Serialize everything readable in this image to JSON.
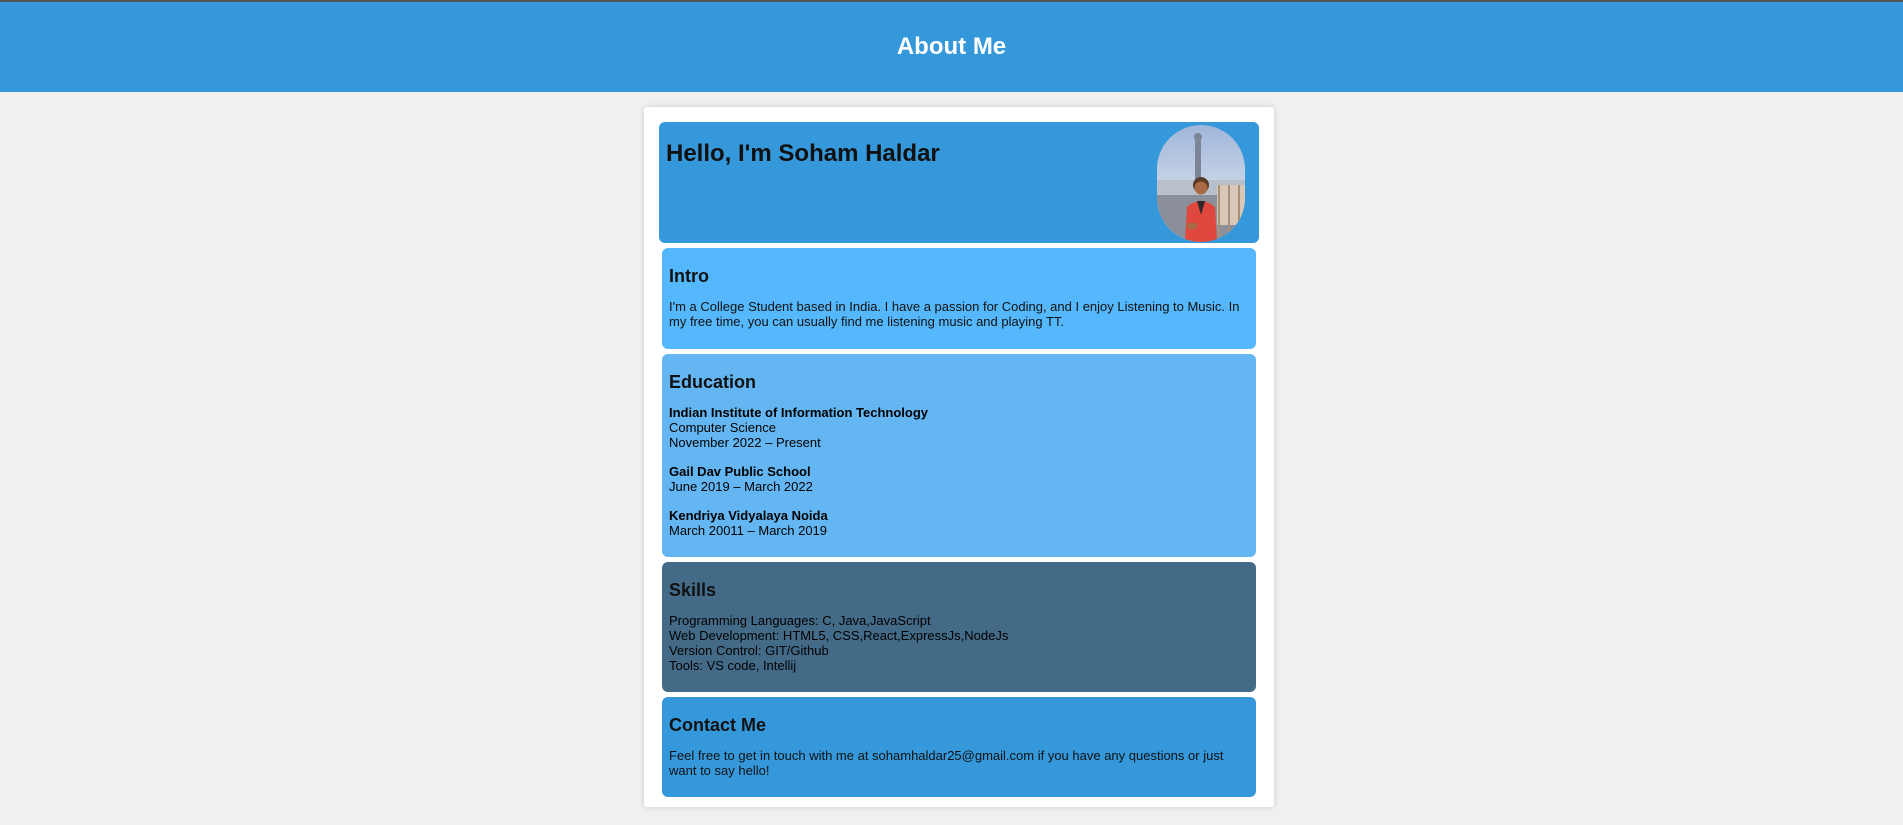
{
  "header": {
    "title": "About Me"
  },
  "hero": {
    "greeting": "Hello, I'm Soham Haldar"
  },
  "intro": {
    "heading": "Intro",
    "text": "I'm a College Student based in India. I have a passion for Coding, and I enjoy Listening to Music. In my free time, you can usually find me listening music and playing TT."
  },
  "education": {
    "heading": "Education",
    "items": [
      {
        "school": "Indian Institute of Information Technology",
        "field": "Computer Science",
        "dates": "November 2022 – Present"
      },
      {
        "school": "Gail Dav Public School",
        "dates": "June 2019 – March 2022"
      },
      {
        "school": "Kendriya Vidyalaya Noida",
        "dates": "March 20011 – March 2019"
      }
    ]
  },
  "skills": {
    "heading": "Skills",
    "items": [
      "Programming Languages: C, Java,JavaScript",
      "Web Development: HTML5, CSS,React,ExpressJs,NodeJs",
      "Version Control: GIT/Github",
      "Tools: VS code, Intellij"
    ]
  },
  "contact": {
    "heading": "Contact Me",
    "text": "Feel free to get in touch with me at sohamhaldar25@gmail.com if you have any questions or just want to say hello!"
  },
  "colors": {
    "header": "#3498db",
    "intro": "#56b8fc",
    "education": "#63b6f1",
    "skills": "#436b88",
    "contact": "#3498db",
    "page_background": "#f0f0f0"
  }
}
